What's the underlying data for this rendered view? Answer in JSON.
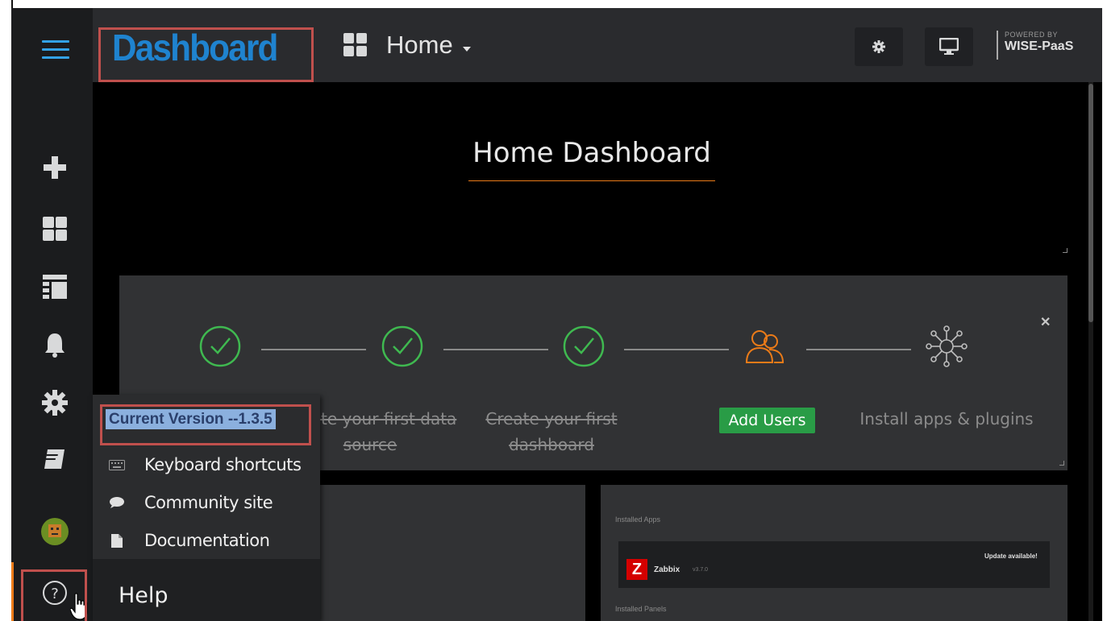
{
  "header": {
    "brand": "Dashboard",
    "home_label": "Home",
    "powered_by_small": "POWERED BY",
    "powered_by_brand": "WISE-PaaS"
  },
  "sidebar": {
    "items": [
      {
        "name": "create",
        "icon": "plus-icon"
      },
      {
        "name": "dashboards",
        "icon": "grid-icon"
      },
      {
        "name": "playlists",
        "icon": "list-icon"
      },
      {
        "name": "alerting",
        "icon": "bell-icon"
      },
      {
        "name": "configuration",
        "icon": "gear-icon"
      },
      {
        "name": "docs",
        "icon": "book-icon"
      },
      {
        "name": "profile",
        "icon": "avatar-icon"
      },
      {
        "name": "help",
        "icon": "question-circle-icon"
      }
    ]
  },
  "main": {
    "title": "Home Dashboard",
    "steps": [
      {
        "label": "Create your first data source",
        "status": "done",
        "icon": "check-circle-icon"
      },
      {
        "label": "Create your first dashboard",
        "status": "done",
        "icon": "check-circle-icon"
      },
      {
        "label": "Add Users",
        "status": "active",
        "icon": "users-icon"
      },
      {
        "label": "Install apps & plugins",
        "status": "todo",
        "icon": "plugin-icon"
      }
    ],
    "installed_apps_label": "Installed Apps",
    "installed_panels_label": "Installed Panels",
    "app": {
      "logo_letter": "Z",
      "name": "Zabbix",
      "version": "v3.7.0",
      "update_text": "Update available!"
    }
  },
  "help_menu": {
    "version": "Current Version --1.3.5",
    "items": [
      {
        "label": "Keyboard shortcuts",
        "icon": "keyboard-icon"
      },
      {
        "label": "Community site",
        "icon": "comment-icon"
      },
      {
        "label": "Documentation",
        "icon": "document-icon"
      }
    ],
    "title": "Help"
  },
  "colors": {
    "brand_blue": "#1f83cf",
    "success_green": "#299c46",
    "step_green": "#3fb950",
    "accent_orange": "#eb7b18",
    "annotation_red": "#c0504d"
  }
}
